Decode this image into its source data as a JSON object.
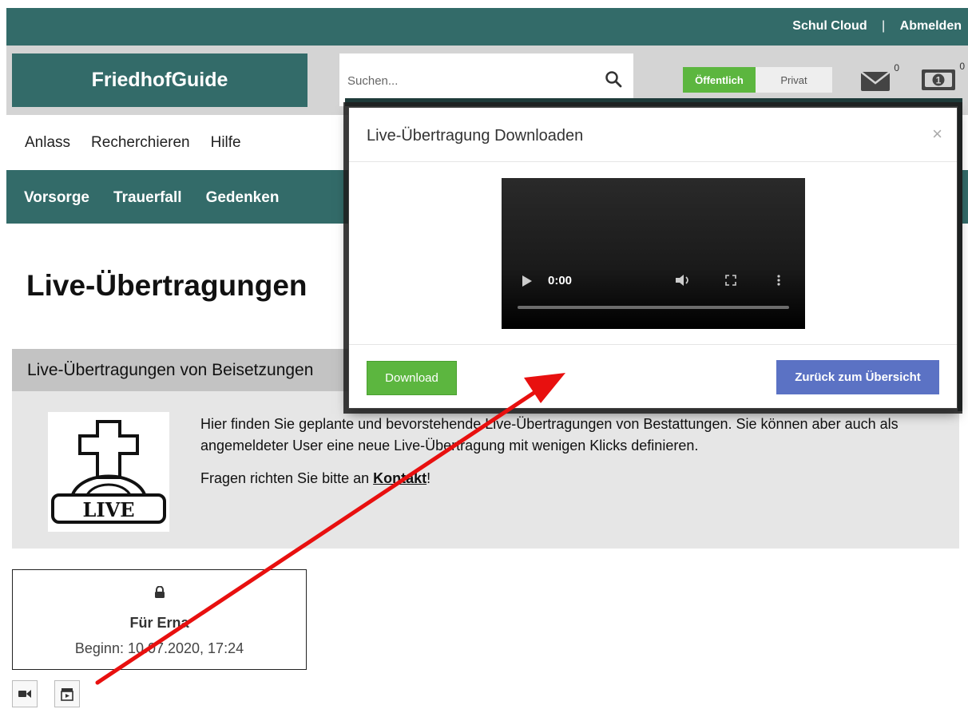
{
  "topbar": {
    "school_cloud": "Schul Cloud",
    "separator": "|",
    "logout": "Abmelden"
  },
  "header": {
    "logo": "FriedhofGuide",
    "search_placeholder": "Suchen...",
    "visibility": {
      "public": "Öffentlich",
      "private": "Privat"
    },
    "messages_count": "0",
    "wallet_count": "0"
  },
  "nav": {
    "items": [
      "Anlass",
      "Recherchieren",
      "Hilfe"
    ]
  },
  "subnav": {
    "items": [
      "Vorsorge",
      "Trauerfall",
      "Gedenken"
    ]
  },
  "page": {
    "title": "Live-Übertragungen",
    "section_title": "Live-Übertragungen von Beisetzungen",
    "image_text": "LIVE",
    "intro": "Hier finden Sie geplante und bevorstehende Live-Übertragungen von Bestattungen. Sie können aber auch als angemeldeter User eine neue Live-Übertragung mit wenigen Klicks definieren.",
    "contact_prefix": "Fragen richten Sie bitte an ",
    "contact_link": "Kontakt",
    "contact_suffix": "!"
  },
  "card": {
    "name": "Für Erna",
    "begin": "Beginn: 10.07.2020, 17:24"
  },
  "modal": {
    "title": "Live-Übertragung Downloaden",
    "close": "×",
    "video_time": "0:00",
    "download": "Download",
    "back": "Zurück zum Übersicht"
  },
  "colors": {
    "brand": "#336b69",
    "green": "#5cb63f",
    "blue": "#5b72c4",
    "arrow": "#e8100f"
  }
}
